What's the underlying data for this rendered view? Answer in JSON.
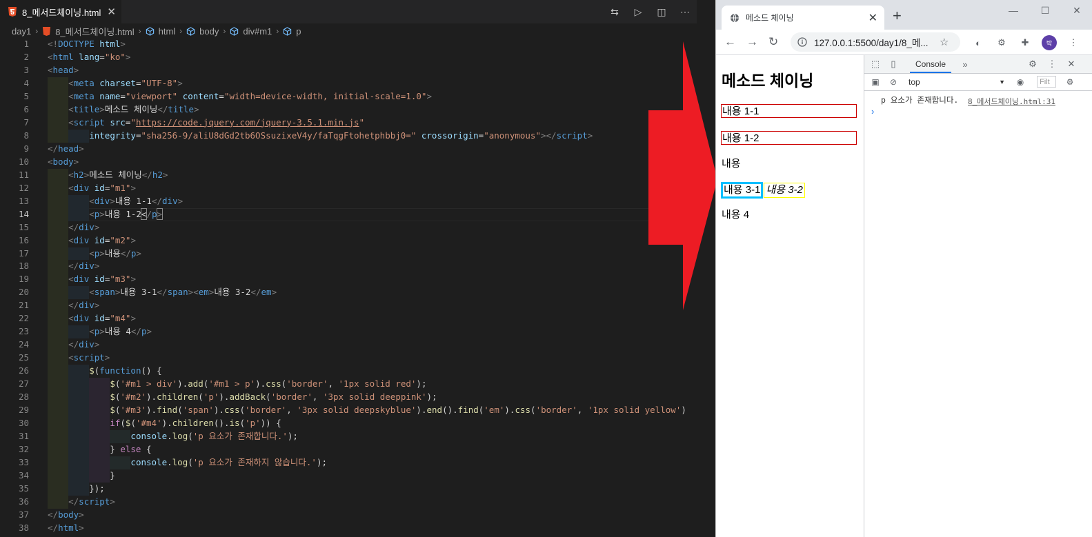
{
  "editor": {
    "tab_title": "8_메서드체이닝.html",
    "breadcrumb": [
      "day1",
      "8_메서드체이닝.html",
      "html",
      "body",
      "div#m1",
      "p"
    ],
    "active_line": 14,
    "lines": [
      "1",
      "2",
      "3",
      "4",
      "5",
      "6",
      "7",
      "8",
      "9",
      "10",
      "11",
      "12",
      "13",
      "14",
      "15",
      "16",
      "17",
      "18",
      "19",
      "20",
      "21",
      "22",
      "23",
      "24",
      "25",
      "26",
      "27",
      "28",
      "29",
      "30",
      "31",
      "32",
      "33",
      "34",
      "35",
      "36",
      "37",
      "38"
    ]
  },
  "browser": {
    "tab_title": "메소드 체이닝",
    "url": "127.0.0.1:5500/day1/8_메...",
    "avatar_letter": "박",
    "page": {
      "heading": "메소드 체이닝",
      "m1_div": "내용 1-1",
      "m1_p": "내용 1-2",
      "m2_p": "내용",
      "m3_span": "내용 3-1",
      "m3_em": "내용 3-2",
      "m4_p": "내용 4"
    },
    "devtools": {
      "tab_console": "Console",
      "context": "top",
      "filter_placeholder": "Filt",
      "log_message": "p 요소가 존재합니다.",
      "log_source": "8_메서드체이닝.html:31",
      "prompt": "›"
    }
  },
  "colors": {
    "red_border": "#cc0000",
    "deepskyblue": "#00bfff",
    "yellow": "#ffff00",
    "arrow": "#ed1c24"
  }
}
